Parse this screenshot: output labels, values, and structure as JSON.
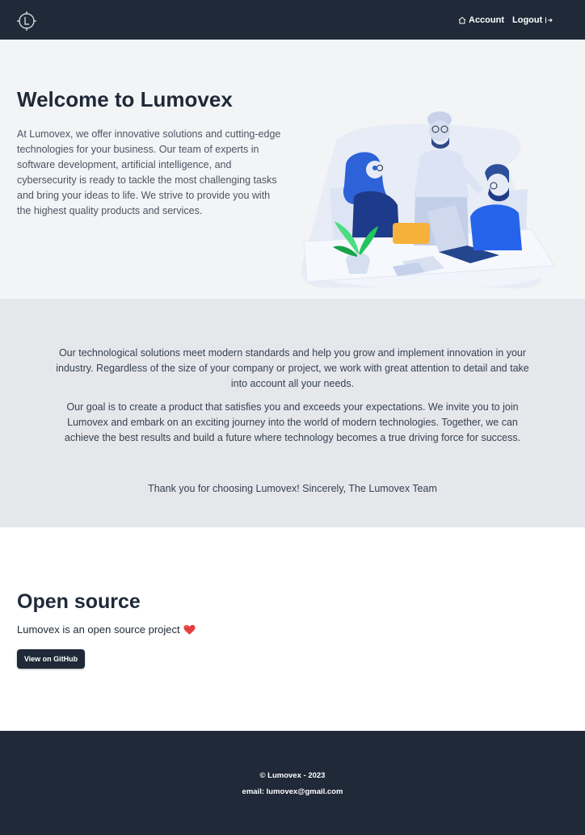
{
  "nav": {
    "logo_icon": "clock-logo-icon",
    "account_label": "Account",
    "account_icon": "home-icon",
    "logout_label": "Logout",
    "logout_icon": "logout-icon"
  },
  "hero": {
    "title": "Welcome to Lumovex",
    "text": "At Lumovex, we offer innovative solutions and cutting-edge technologies for your business. Our team of experts in software development, artificial intelligence, and cybersecurity is ready to tackle the most challenging tasks and bring your ideas to life. We strive to provide you with the highest quality products and services.",
    "illustration": "team-working-illustration"
  },
  "about": {
    "paragraph_1": "Our technological solutions meet modern standards and help you grow and implement innovation in your industry. Regardless of the size of your company or project, we work with great attention to detail and take into account all your needs.",
    "paragraph_2": "Our goal is to create a product that satisfies you and exceeds your expectations. We invite you to join Lumovex and embark on an exciting journey into the world of modern technologies. Together, we can achieve the best results and build a future where technology becomes a true driving force for success.",
    "paragraph_3": "Thank you for choosing Lumovex! Sincerely, The Lumovex Team"
  },
  "open_source": {
    "title": "Open source",
    "text": "Lumovex is an open source project",
    "heart_icon": "heart-icon",
    "button_label": "View on GitHub"
  },
  "footer": {
    "copyright": "© Lumovex - 2023",
    "email": "email: lumovex@gmail.com"
  },
  "colors": {
    "dark": "#1f2937",
    "hero_bg": "#f3f4f6",
    "about_bg": "#e5e7eb",
    "accent_blue": "#2563eb",
    "heart": "#e53e3e"
  }
}
